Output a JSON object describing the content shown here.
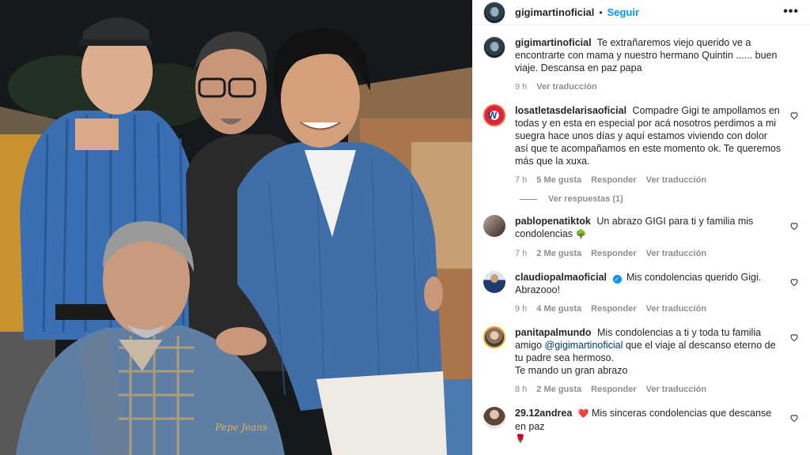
{
  "post": {
    "author": "gigimartinoficial",
    "separator": "•",
    "follow_label": "Seguir",
    "more_label": "•••"
  },
  "photo": {
    "jacket_label": "Pepe Jeans"
  },
  "caption": {
    "user": "gigimartinoficial",
    "text": "Te extrañaremos viejo querido ve a encontrarte con mama y nuestro hermano Quintin ...... buen viaje. Descansa en paz papa",
    "time": "9 h",
    "translate": "Ver traducción"
  },
  "comments": [
    {
      "user": "losatletasdelarisaoficial",
      "text": "Compadre Gigi te ampollamos en todas y en esta en especial por acá nosotros perdimos a mi suegra hace unos días y aquí estamos viviendo con dolor así que te acompañamos en este momento ok. Te queremos más que la xuxa.",
      "time": "7 h",
      "likes": "5 Me gusta",
      "reply": "Responder",
      "translate": "Ver traducción",
      "replies": "Ver respuestas (1)"
    },
    {
      "user": "pablopenatiktok",
      "text": "Un abrazo GIGI para ti y familia mis condolencias",
      "emoji": "🌳",
      "time": "7 h",
      "likes": "2 Me gusta",
      "reply": "Responder",
      "translate": "Ver traducción"
    },
    {
      "user": "claudiopalmaoficial",
      "text": "Mis condolencias querido Gigi. Abrazooo!",
      "time": "9 h",
      "likes": "4 Me gusta",
      "reply": "Responder",
      "translate": "Ver traducción"
    },
    {
      "user": "panitapalmundo",
      "text_before": "Mis condolencias a ti y toda tu familia amigo",
      "mention": "@gigimartinoficial",
      "text_after": "que el viaje al descanso eterno de tu padre sea hermoso.",
      "text_line2": "Te mando un gran abrazo",
      "time": "8 h",
      "likes": "2 Me gusta",
      "reply": "Responder",
      "translate": "Ver traducción"
    },
    {
      "user": "29.12andrea",
      "emoji": "❤️",
      "text": "Mis sinceras condolencias que descanse en paz",
      "emoji2": "🌹"
    }
  ],
  "colors": {
    "link_blue": "#0095f6",
    "muted": "#8e8e8e",
    "text": "#262626"
  }
}
